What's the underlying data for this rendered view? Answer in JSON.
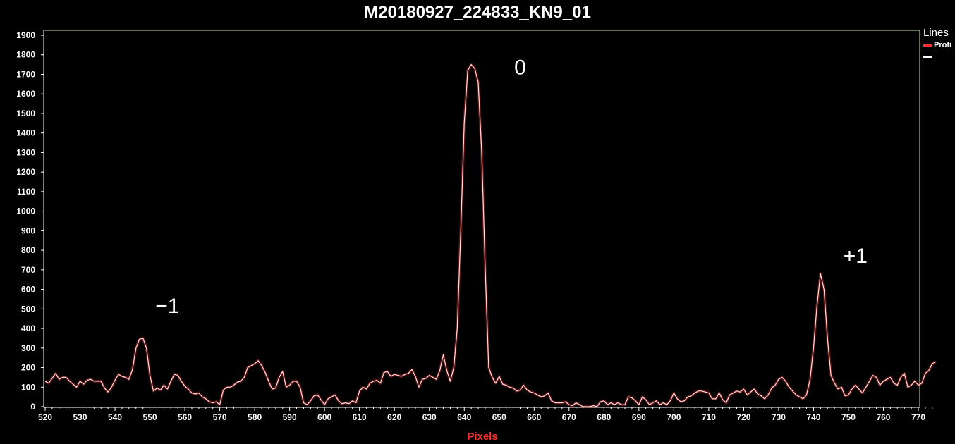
{
  "chart_data": {
    "type": "line",
    "title": "M20180927_224833_KN9_01",
    "xlabel": "Pixels",
    "ylabel": "",
    "xlim": [
      520,
      775
    ],
    "ylim": [
      0,
      1930
    ],
    "xticks": [
      520,
      530,
      540,
      550,
      560,
      570,
      580,
      590,
      600,
      610,
      620,
      630,
      640,
      650,
      660,
      670,
      680,
      690,
      700,
      710,
      720,
      730,
      740,
      750,
      760,
      770
    ],
    "yticks": [
      0,
      100,
      200,
      300,
      400,
      500,
      600,
      700,
      800,
      900,
      1000,
      1100,
      1200,
      1300,
      1400,
      1500,
      1600,
      1700,
      1800,
      1900
    ],
    "grid": false,
    "legend": {
      "title": "Lines",
      "position": "right",
      "entries": [
        {
          "label": "Profi",
          "color": "#ff3030"
        },
        {
          "label": "",
          "color": "#ffffff"
        }
      ]
    },
    "annotations": [
      {
        "text": "−1",
        "x": 555,
        "y": 480
      },
      {
        "text": "0",
        "x": 656,
        "y": 1700
      },
      {
        "text": "+1",
        "x": 752,
        "y": 735
      }
    ],
    "series": [
      {
        "name": "Profi",
        "color": "#ff3030",
        "x": [
          520,
          521,
          522,
          523,
          524,
          525,
          526,
          527,
          528,
          529,
          530,
          531,
          532,
          533,
          534,
          535,
          536,
          537,
          538,
          539,
          540,
          541,
          542,
          543,
          544,
          545,
          546,
          547,
          548,
          549,
          550,
          551,
          552,
          553,
          554,
          555,
          556,
          557,
          558,
          559,
          560,
          561,
          562,
          563,
          564,
          565,
          566,
          567,
          568,
          569,
          570,
          571,
          572,
          573,
          574,
          575,
          576,
          577,
          578,
          579,
          580,
          581,
          582,
          583,
          584,
          585,
          586,
          587,
          588,
          589,
          590,
          591,
          592,
          593,
          594,
          595,
          596,
          597,
          598,
          599,
          600,
          601,
          602,
          603,
          604,
          605,
          606,
          607,
          608,
          609,
          610,
          611,
          612,
          613,
          614,
          615,
          616,
          617,
          618,
          619,
          620,
          621,
          622,
          623,
          624,
          625,
          626,
          627,
          628,
          629,
          630,
          631,
          632,
          633,
          634,
          635,
          636,
          637,
          638,
          639,
          640,
          641,
          642,
          643,
          644,
          645,
          646,
          647,
          648,
          649,
          650,
          651,
          652,
          653,
          654,
          655,
          656,
          657,
          658,
          659,
          660,
          661,
          662,
          663,
          664,
          665,
          666,
          667,
          668,
          669,
          670,
          671,
          672,
          673,
          674,
          675,
          676,
          677,
          678,
          679,
          680,
          681,
          682,
          683,
          684,
          685,
          686,
          687,
          688,
          689,
          690,
          691,
          692,
          693,
          694,
          695,
          696,
          697,
          698,
          699,
          700,
          701,
          702,
          703,
          704,
          705,
          706,
          707,
          708,
          709,
          710,
          711,
          712,
          713,
          714,
          715,
          716,
          717,
          718,
          719,
          720,
          721,
          722,
          723,
          724,
          725,
          726,
          727,
          728,
          729,
          730,
          731,
          732,
          733,
          734,
          735,
          736,
          737,
          738,
          739,
          740,
          741,
          742,
          743,
          744,
          745,
          746,
          747,
          748,
          749,
          750,
          751,
          752,
          753,
          754,
          755,
          756,
          757,
          758,
          759,
          760,
          761,
          762,
          763,
          764,
          765,
          766,
          767,
          768,
          769,
          770,
          771,
          772,
          773,
          774,
          775
        ],
        "y": [
          130,
          120,
          145,
          170,
          140,
          150,
          150,
          130,
          115,
          100,
          130,
          115,
          135,
          140,
          130,
          130,
          130,
          95,
          75,
          100,
          135,
          165,
          155,
          150,
          140,
          190,
          300,
          345,
          350,
          300,
          160,
          80,
          95,
          85,
          110,
          90,
          130,
          165,
          160,
          130,
          105,
          90,
          70,
          65,
          70,
          50,
          40,
          25,
          20,
          25,
          10,
          85,
          100,
          100,
          110,
          125,
          130,
          150,
          200,
          210,
          220,
          235,
          210,
          175,
          130,
          90,
          95,
          150,
          180,
          100,
          110,
          130,
          130,
          100,
          20,
          10,
          30,
          55,
          60,
          35,
          10,
          40,
          50,
          60,
          30,
          15,
          20,
          15,
          30,
          20,
          80,
          100,
          90,
          120,
          130,
          135,
          120,
          175,
          180,
          155,
          165,
          160,
          155,
          165,
          170,
          190,
          155,
          100,
          140,
          145,
          160,
          150,
          140,
          185,
          265,
          185,
          130,
          200,
          400,
          900,
          1450,
          1720,
          1750,
          1730,
          1660,
          1300,
          700,
          200,
          150,
          120,
          155,
          115,
          110,
          100,
          95,
          80,
          85,
          110,
          85,
          75,
          70,
          60,
          50,
          55,
          70,
          30,
          20,
          20,
          20,
          25,
          10,
          5,
          20,
          10,
          0,
          0,
          0,
          5,
          0,
          25,
          30,
          10,
          20,
          10,
          20,
          10,
          10,
          50,
          45,
          30,
          10,
          50,
          35,
          10,
          20,
          30,
          10,
          20,
          10,
          30,
          70,
          40,
          25,
          30,
          50,
          55,
          70,
          80,
          80,
          75,
          70,
          40,
          40,
          70,
          35,
          20,
          60,
          70,
          80,
          75,
          90,
          60,
          75,
          90,
          65,
          55,
          40,
          60,
          95,
          110,
          140,
          150,
          130,
          100,
          80,
          60,
          50,
          40,
          60,
          140,
          300,
          520,
          680,
          600,
          350,
          160,
          120,
          90,
          100,
          55,
          60,
          90,
          110,
          90,
          70,
          100,
          130,
          160,
          150,
          110,
          130,
          140,
          150,
          120,
          110,
          150,
          170,
          100,
          110,
          130,
          110,
          120,
          170,
          185,
          220,
          230
        ]
      }
    ]
  }
}
